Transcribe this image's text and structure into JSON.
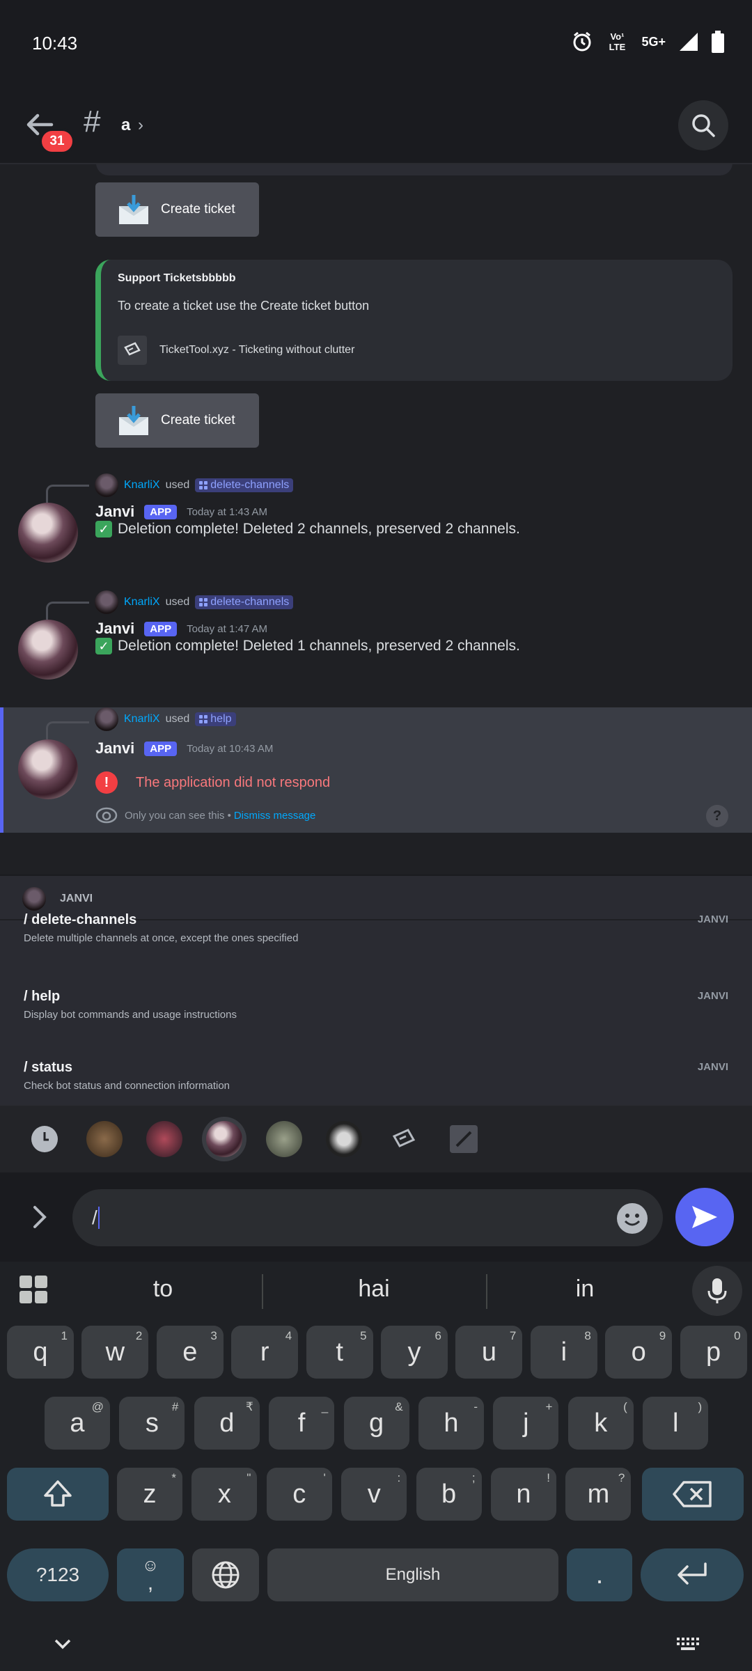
{
  "status": {
    "time": "10:43",
    "volte": "Vo¹ LTE",
    "network": "5G+"
  },
  "header": {
    "badge": "31",
    "hash": "#",
    "channel": "a"
  },
  "embed": {
    "title": "Support Ticketsbbbbb",
    "description": "To create a ticket use the Create ticket button",
    "footer": "TicketTool.xyz - Ticketing without clutter"
  },
  "buttons": {
    "create_ticket_1": "Create ticket",
    "create_ticket_2": "Create ticket"
  },
  "messages": [
    {
      "reply_user": "KnarliX",
      "reply_used": "used",
      "reply_command": "delete-channels",
      "author": "Janvi",
      "tag": "APP",
      "timestamp": "Today at 1:43 AM",
      "text": "Deletion complete! Deleted 2 channels, preserved 2 channels."
    },
    {
      "reply_user": "KnarliX",
      "reply_used": "used",
      "reply_command": "delete-channels",
      "author": "Janvi",
      "tag": "APP",
      "timestamp": "Today at 1:47 AM",
      "text": "Deletion complete! Deleted 1 channels, preserved 2 channels."
    },
    {
      "reply_user": "KnarliX",
      "reply_used": "used",
      "reply_command": "help",
      "author": "Janvi",
      "tag": "APP",
      "timestamp": "Today at 10:43 AM",
      "text": "The application did not respond",
      "ephemeral_note": "Only you can see this •",
      "dismiss": "Dismiss message"
    }
  ],
  "autocomplete": {
    "app_name": "JANVI",
    "commands": [
      {
        "name": "/ delete-channels",
        "description": "Delete multiple channels at once, except the ones specified",
        "source": "JANVI"
      },
      {
        "name": "/ help",
        "description": "Display bot commands and usage instructions",
        "source": "JANVI"
      },
      {
        "name": "/ status",
        "description": "Check bot status and connection information",
        "source": "JANVI"
      }
    ]
  },
  "input": {
    "value": "/"
  },
  "keyboard": {
    "suggestions": [
      "to",
      "hai",
      "in"
    ],
    "row1": [
      [
        "q",
        "1"
      ],
      [
        "w",
        "2"
      ],
      [
        "e",
        "3"
      ],
      [
        "r",
        "4"
      ],
      [
        "t",
        "5"
      ],
      [
        "y",
        "6"
      ],
      [
        "u",
        "7"
      ],
      [
        "i",
        "8"
      ],
      [
        "o",
        "9"
      ],
      [
        "p",
        "0"
      ]
    ],
    "row2": [
      [
        "a",
        "@"
      ],
      [
        "s",
        "#"
      ],
      [
        "d",
        "₹"
      ],
      [
        "f",
        "_"
      ],
      [
        "g",
        "&"
      ],
      [
        "h",
        "-"
      ],
      [
        "j",
        "+"
      ],
      [
        "k",
        "("
      ],
      [
        "l",
        ")"
      ]
    ],
    "row3": [
      [
        "z",
        "*"
      ],
      [
        "x",
        "\""
      ],
      [
        "c",
        "'"
      ],
      [
        "v",
        ":"
      ],
      [
        "b",
        ";"
      ],
      [
        "n",
        "!"
      ],
      [
        "m",
        "?"
      ]
    ],
    "symbols_key": "?123",
    "comma_key": ",",
    "space_label": "English",
    "period_key": "."
  },
  "colors": {
    "accent": "#5865f2",
    "error": "#f23f43",
    "link": "#00a8fc",
    "embed_bar": "#3ba55c"
  }
}
